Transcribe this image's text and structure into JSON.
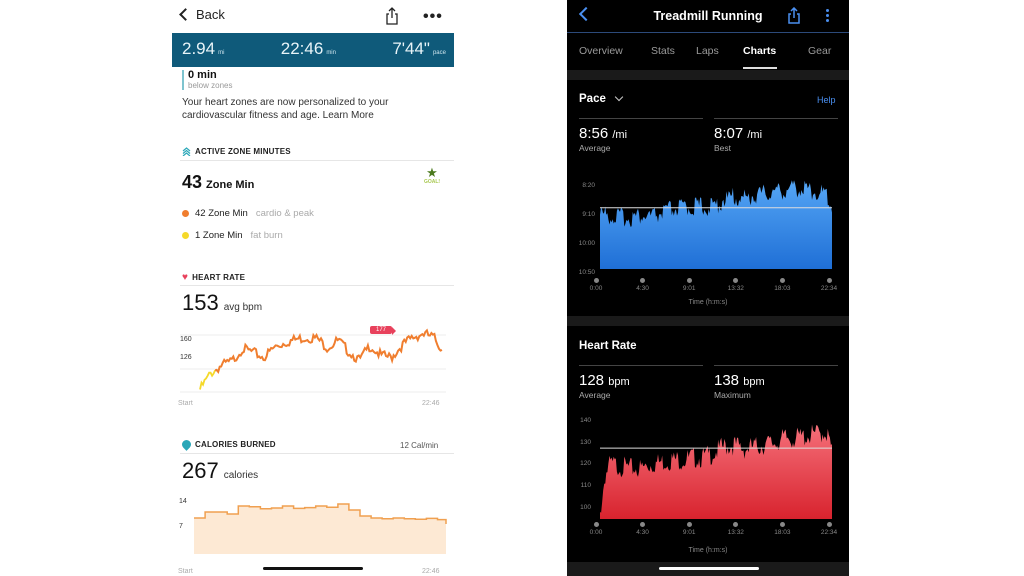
{
  "left_app": {
    "nav": {
      "back_label": "Back",
      "share_icon": "share-icon",
      "more_icon": "more-icon"
    },
    "summary": [
      {
        "value": "2.94",
        "unit": "mi"
      },
      {
        "value": "22:46",
        "unit": "min"
      },
      {
        "value": "7'44\"",
        "unit": "pace"
      }
    ],
    "below_zones": {
      "value": "0 min",
      "label": "below zones"
    },
    "zone_note": "Your heart zones are now personalized to your cardiovascular fitness and age. Learn More",
    "active_zone_minutes": {
      "title": "ACTIVE ZONE MINUTES",
      "total_value": "43",
      "total_unit": "Zone Min",
      "goal_label": "GOAL!",
      "rows": [
        {
          "value": "42 Zone Min",
          "label": "cardio & peak",
          "color": "#f07e2f"
        },
        {
          "value": "1 Zone Min",
          "label": "fat burn",
          "color": "#f5d92a"
        }
      ]
    },
    "heart_rate": {
      "title": "HEART RATE",
      "avg_value": "153",
      "avg_unit": "avg bpm",
      "peak_badge": "177",
      "y_ticks": [
        "160",
        "126"
      ],
      "x_start": "Start",
      "x_end": "22:46",
      "color": "#f07e2f",
      "warmup_color": "#f5d92a"
    },
    "calories": {
      "title": "CALORIES BURNED",
      "rate": "12 Cal/min",
      "total_value": "267",
      "total_unit": "calories",
      "y_ticks": [
        "14",
        "7"
      ],
      "x_start": "Start",
      "x_end": "22:46",
      "line_color": "#f0a050",
      "fill_color": "#fde9d4"
    }
  },
  "right_app": {
    "nav": {
      "title": "Treadmill Running",
      "back_icon": "back-icon",
      "share_icon": "share-icon",
      "more_icon": "more-icon"
    },
    "tabs": [
      {
        "label": "Overview",
        "active": false
      },
      {
        "label": "Stats",
        "active": false
      },
      {
        "label": "Laps",
        "active": false
      },
      {
        "label": "Charts",
        "active": true
      },
      {
        "label": "Gear",
        "active": false
      }
    ],
    "pace": {
      "title": "Pace",
      "help_label": "Help",
      "stats": [
        {
          "value": "8:56",
          "unit": "/mi",
          "label": "Average"
        },
        {
          "value": "8:07",
          "unit": "/mi",
          "label": "Best"
        }
      ],
      "y_ticks": [
        "8:20",
        "9:10",
        "10:00",
        "10:50"
      ],
      "x_ticks": [
        "0:00",
        "4:30",
        "9:01",
        "13:32",
        "18:03",
        "22:34"
      ],
      "x_label": "Time (h:m:s)",
      "color": "#2f86e8"
    },
    "heart_rate": {
      "title": "Heart Rate",
      "stats": [
        {
          "value": "128",
          "unit": "bpm",
          "label": "Average"
        },
        {
          "value": "138",
          "unit": "bpm",
          "label": "Maximum"
        }
      ],
      "y_ticks": [
        "140",
        "130",
        "120",
        "110",
        "100"
      ],
      "x_ticks": [
        "0:00",
        "4:30",
        "9:01",
        "13:32",
        "18:03",
        "22:34"
      ],
      "x_label": "Time (h:m:s)",
      "color": "#e8333d"
    }
  },
  "chart_data": [
    {
      "type": "line",
      "title": "HEART RATE",
      "xlabel": "",
      "ylabel": "bpm",
      "x_range": [
        "Start",
        "22:46"
      ],
      "ylim": [
        95,
        175
      ],
      "y_ticks": [
        160,
        126
      ],
      "peak": 177,
      "x": [
        0,
        1,
        2,
        3,
        4,
        5,
        6,
        7,
        8,
        9,
        10,
        11,
        12,
        13,
        14,
        15,
        16,
        17,
        18,
        19,
        20,
        21,
        22,
        22.77
      ],
      "values": [
        108,
        124,
        132,
        136,
        149,
        145,
        140,
        150,
        155,
        158,
        160,
        159,
        150,
        157,
        146,
        137,
        152,
        142,
        140,
        152,
        160,
        164,
        160,
        148
      ]
    },
    {
      "type": "area",
      "title": "CALORIES BURNED",
      "ylabel": "Cal/min",
      "x_range": [
        "Start",
        "22:46"
      ],
      "ylim": [
        0,
        16
      ],
      "y_ticks": [
        14,
        7
      ],
      "x": [
        0,
        1,
        2,
        3,
        4,
        5,
        6,
        7,
        8,
        9,
        10,
        11,
        12,
        13,
        14,
        15,
        16,
        17,
        18,
        19,
        20,
        21,
        22,
        22.77
      ],
      "values": [
        9,
        10.5,
        10.5,
        10,
        12,
        11.8,
        11.3,
        11.5,
        12,
        11.4,
        11.6,
        12,
        11.7,
        12.5,
        11,
        9.5,
        9,
        8.8,
        9,
        8.8,
        8.7,
        8.9,
        8.6,
        7.5
      ]
    },
    {
      "type": "area",
      "title": "Pace",
      "xlabel": "Time (h:m:s)",
      "ylabel": "min/mi",
      "x_ticks": [
        "0:00",
        "4:30",
        "9:01",
        "13:32",
        "18:03",
        "22:34"
      ],
      "y_ticks": [
        "8:20",
        "9:10",
        "10:00",
        "10:50"
      ],
      "inverted_y": true,
      "ylim_seconds": [
        650,
        490
      ],
      "average_seconds": 536,
      "x_minutes": [
        0,
        1,
        2,
        3,
        4,
        5,
        6,
        7,
        8,
        9,
        10,
        11,
        12,
        13,
        14,
        15,
        16,
        17,
        18,
        19,
        20,
        21,
        22,
        22.57
      ],
      "values_seconds": [
        555,
        560,
        562,
        563,
        560,
        562,
        555,
        548,
        545,
        543,
        542,
        545,
        530,
        525,
        528,
        522,
        518,
        515,
        512,
        508,
        510,
        515,
        520,
        545
      ]
    },
    {
      "type": "area",
      "title": "Heart Rate",
      "xlabel": "Time (h:m:s)",
      "ylabel": "bpm",
      "x_ticks": [
        "0:00",
        "4:30",
        "9:01",
        "13:32",
        "18:03",
        "22:34"
      ],
      "ylim": [
        95,
        142
      ],
      "average": 128,
      "x_minutes": [
        0,
        0.5,
        1,
        2,
        3,
        4,
        5,
        6,
        7,
        8,
        9,
        10,
        11,
        12,
        13,
        14,
        15,
        16,
        17,
        18,
        19,
        20,
        21,
        22,
        22.57
      ],
      "values": [
        100,
        118,
        123,
        122,
        121,
        121,
        123,
        124,
        125,
        125,
        126,
        126,
        128,
        131,
        132,
        130,
        131,
        132,
        133,
        135,
        135,
        136,
        137,
        138,
        130
      ]
    }
  ]
}
